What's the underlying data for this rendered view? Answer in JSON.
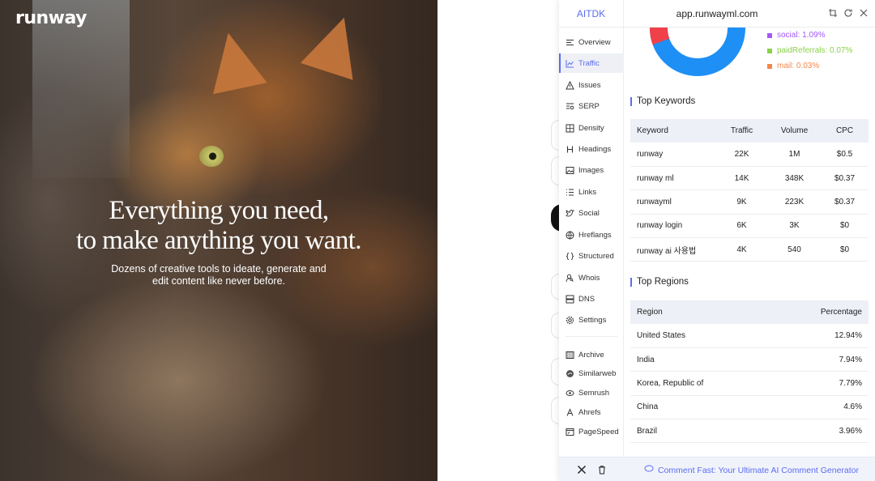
{
  "hero": {
    "logo": "runway",
    "headline_line1": "Everything you need,",
    "headline_line2": "to make anything you want.",
    "sub_line1": "Dozens of creative tools to ideate, generate and",
    "sub_line2": "edit content like never before."
  },
  "extension": {
    "brand": "AITDK",
    "domain": "app.runwayml.com",
    "nav": [
      {
        "label": "Overview",
        "icon": "list-icon"
      },
      {
        "label": "Traffic",
        "icon": "chart-line-icon",
        "active": true
      },
      {
        "label": "Issues",
        "icon": "warning-icon"
      },
      {
        "label": "SERP",
        "icon": "serp-icon"
      },
      {
        "label": "Density",
        "icon": "density-icon"
      },
      {
        "label": "Headings",
        "icon": "heading-icon"
      },
      {
        "label": "Images",
        "icon": "image-icon"
      },
      {
        "label": "Links",
        "icon": "links-icon"
      },
      {
        "label": "Social",
        "icon": "twitter-icon"
      },
      {
        "label": "Hreflangs",
        "icon": "globe-icon"
      },
      {
        "label": "Structured",
        "icon": "braces-icon"
      },
      {
        "label": "Whois",
        "icon": "user-search-icon"
      },
      {
        "label": "DNS",
        "icon": "dns-icon"
      },
      {
        "label": "Settings",
        "icon": "gear-icon"
      }
    ],
    "external": [
      {
        "label": "Archive",
        "icon": "archive-icon"
      },
      {
        "label": "Similarweb",
        "icon": "similarweb-icon"
      },
      {
        "label": "Semrush",
        "icon": "semrush-icon"
      },
      {
        "label": "Ahrefs",
        "icon": "ahrefs-icon"
      },
      {
        "label": "PageSpeed",
        "icon": "pagespeed-icon"
      }
    ],
    "traffic_sources": {
      "legend": [
        {
          "label": "social: 1.09%",
          "color": "#a259f7"
        },
        {
          "label": "paidReferrals: 0.07%",
          "color": "#8bd14a"
        },
        {
          "label": "mail: 0.03%",
          "color": "#f5874a"
        }
      ],
      "donut_colors": {
        "main": "#1e8ff5",
        "secondary": "#f0404a"
      }
    },
    "top_keywords": {
      "title": "Top Keywords",
      "headers": [
        "Keyword",
        "Traffic",
        "Volume",
        "CPC"
      ],
      "rows": [
        [
          "runway",
          "22K",
          "1M",
          "$0.5"
        ],
        [
          "runway ml",
          "14K",
          "348K",
          "$0.37"
        ],
        [
          "runwayml",
          "9K",
          "223K",
          "$0.37"
        ],
        [
          "runway login",
          "6K",
          "3K",
          "$0"
        ],
        [
          "runway ai 사용법",
          "4K",
          "540",
          "$0"
        ]
      ]
    },
    "top_regions": {
      "title": "Top Regions",
      "headers": [
        "Region",
        "Percentage"
      ],
      "rows": [
        [
          "United States",
          "12.94%"
        ],
        [
          "India",
          "7.94%"
        ],
        [
          "Korea, Republic of",
          "7.79%"
        ],
        [
          "China",
          "4.6%"
        ],
        [
          "Brazil",
          "3.96%"
        ]
      ]
    },
    "promo": "Comment Fast: Your Ultimate AI Comment Generator",
    "accent": "#5b6cf0"
  }
}
